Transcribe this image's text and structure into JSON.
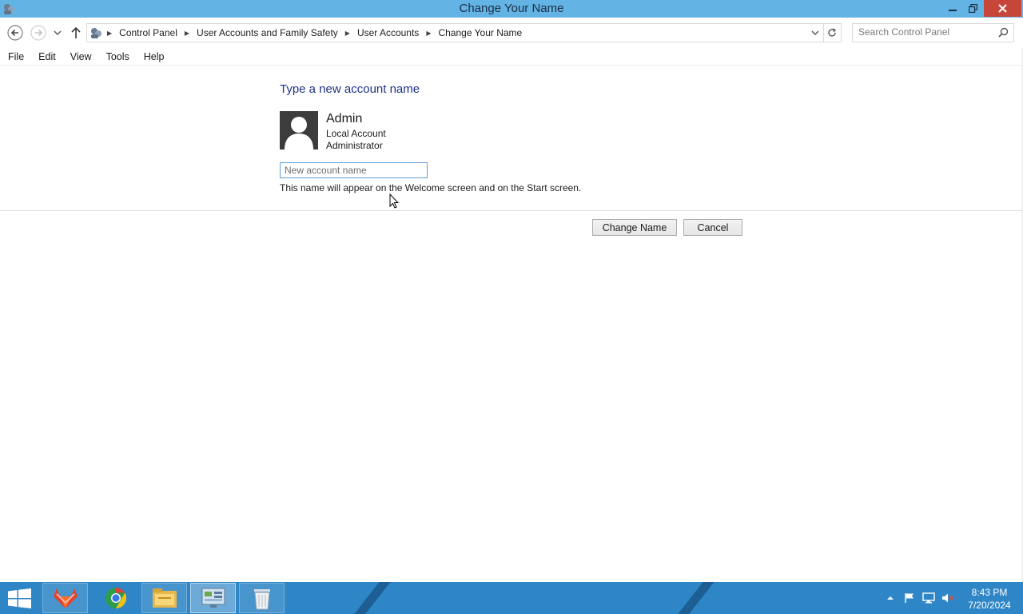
{
  "window": {
    "title": "Change Your Name"
  },
  "breadcrumb": [
    "Control Panel",
    "User Accounts and Family Safety",
    "User Accounts",
    "Change Your Name"
  ],
  "search": {
    "placeholder": "Search Control Panel"
  },
  "menu": [
    "File",
    "Edit",
    "View",
    "Tools",
    "Help"
  ],
  "content": {
    "heading": "Type a new account name",
    "account": {
      "name": "Admin",
      "type": "Local Account",
      "role": "Administrator"
    },
    "input": {
      "placeholder": "New account name",
      "value": ""
    },
    "hint": "This name will appear on the Welcome screen and on the Start screen.",
    "buttons": {
      "change": "Change Name",
      "cancel": "Cancel"
    }
  },
  "taskbar": {
    "apps": [
      "gitlab-icon",
      "chrome-icon",
      "file-explorer-icon",
      "control-panel-icon",
      "recycle-icon"
    ],
    "clock": {
      "time": "8:43 PM",
      "date": "7/20/2024"
    }
  },
  "colors": {
    "titlebar": "#63b3e4",
    "close": "#c7463a",
    "heading": "#1e3287",
    "taskbar": "#2f86c7"
  }
}
